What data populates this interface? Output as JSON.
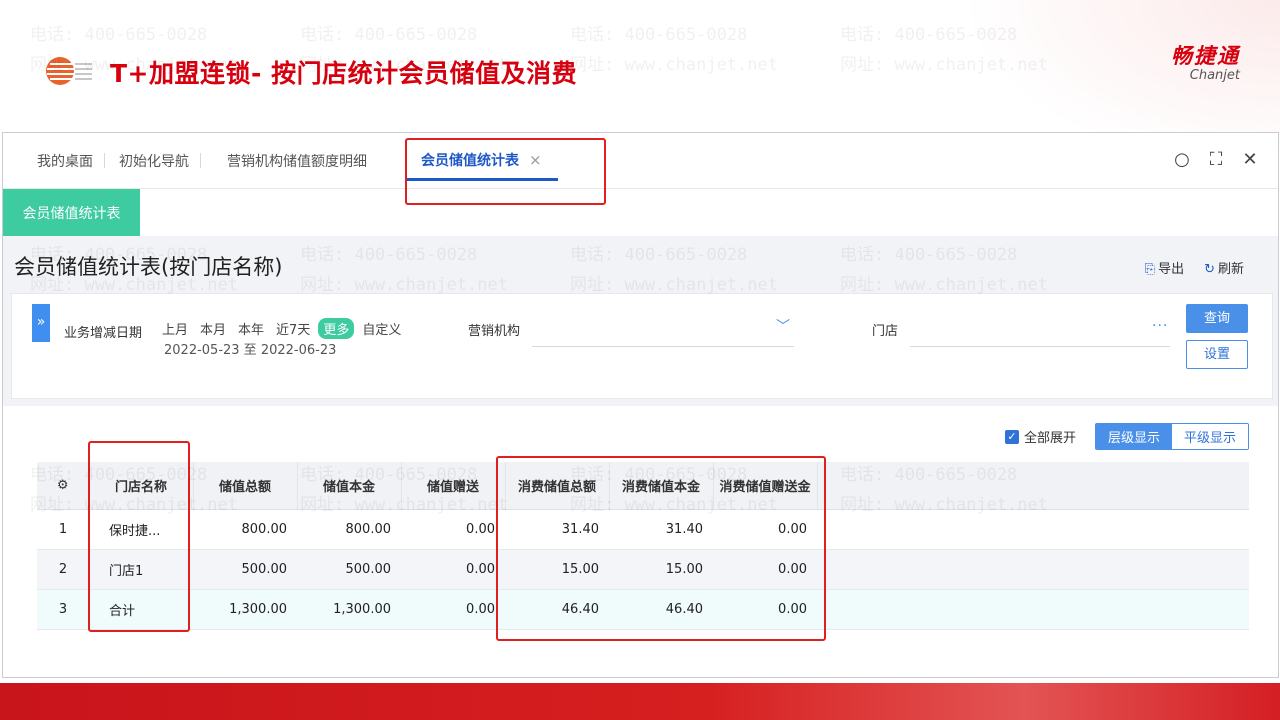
{
  "slide": {
    "title": "T+加盟连锁- 按门店统计会员储值及消费",
    "brand_cn": "畅捷通",
    "brand_en": "Chanjet",
    "watermark_phone": "电话: 400-665-0028",
    "watermark_site": "网址: www.chanjet.net"
  },
  "tabs": [
    {
      "label": "我的桌面"
    },
    {
      "label": "初始化导航"
    },
    {
      "label": "营销机构储值额度明细"
    },
    {
      "label": "会员储值统计表"
    }
  ],
  "tab_close": "×",
  "window_icons": {
    "search": "○",
    "maximize": "⛶",
    "close": "✕"
  },
  "module_button": "会员储值统计表",
  "report": {
    "title": "会员储值统计表(按门店名称)",
    "export_label": "导出",
    "refresh_label": "刷新"
  },
  "filters": {
    "date_label": "业务增减日期",
    "date_options": [
      "上月",
      "本月",
      "本年",
      "近7天",
      "更多",
      "自定义"
    ],
    "date_range": "2022-05-23 至 2022-06-23",
    "org_label": "营销机构",
    "store_label": "门店",
    "query_button": "查询",
    "settings_button": "设置"
  },
  "view": {
    "expand_all": "全部展开",
    "hierarchical": "层级显示",
    "flat": "平级显示"
  },
  "table": {
    "headers": [
      "门店名称",
      "储值总额",
      "储值本金",
      "储值赠送",
      "消费储值总额",
      "消费储值本金",
      "消费储值赠送金"
    ],
    "rows": [
      {
        "index": "1",
        "name": "保时捷...",
        "total": "800.00",
        "principal": "800.00",
        "gift": "0.00",
        "spend_total": "31.40",
        "spend_principal": "31.40",
        "spend_gift": "0.00"
      },
      {
        "index": "2",
        "name": "门店1",
        "total": "500.00",
        "principal": "500.00",
        "gift": "0.00",
        "spend_total": "15.00",
        "spend_principal": "15.00",
        "spend_gift": "0.00"
      },
      {
        "index": "3",
        "name": "合计",
        "total": "1,300.00",
        "principal": "1,300.00",
        "gift": "0.00",
        "spend_total": "46.40",
        "spend_principal": "46.40",
        "spend_gift": "0.00"
      }
    ]
  },
  "colors": {
    "title_red": "#d7000f",
    "accent_blue": "#1f58c7",
    "green": "#3ecba0",
    "annotation": "#e0201f"
  }
}
